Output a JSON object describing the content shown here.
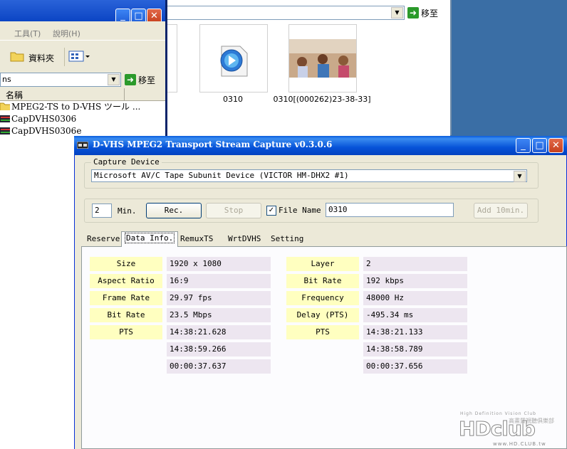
{
  "explorer": {
    "menu": [
      "工具(T)",
      "說明(H)"
    ],
    "toolbar_folder_label": "資料夾",
    "address_value": "ns",
    "go_label": "移至",
    "column_header": "名稱",
    "files": [
      {
        "name": "MPEG2-TS to D-VHS ツール ...",
        "type": "folder"
      },
      {
        "name": "CapDVHS0306",
        "type": "app"
      },
      {
        "name": "CapDVHS0306e",
        "type": "app"
      }
    ]
  },
  "thumbs": {
    "go_label": "移至",
    "items": [
      {
        "label": "0310",
        "kind": "media-icon"
      },
      {
        "label": "0310[(000262)23-38-33]",
        "kind": "video-frame"
      }
    ]
  },
  "dialog": {
    "title": "D-VHS MPEG2 Transport Stream Capture v0.3.0.6",
    "capture_device": {
      "label": "Capture Device",
      "selected": "Microsoft AV/C Tape Subunit Device (VICTOR HM-DHX2 #1)"
    },
    "record": {
      "minutes_value": "2",
      "minutes_label": "Min.",
      "rec_label": "Rec.",
      "stop_label": "Stop",
      "filename_checked": true,
      "filename_label": "File Name",
      "filename_value": "0310",
      "add_label": "Add 10min."
    },
    "tabs": [
      "Reserve",
      "Data Info.",
      "RemuxTS",
      "WrtDVHS",
      "Setting"
    ],
    "active_tab": "Data Info.",
    "video": [
      {
        "label": "Size",
        "value": "1920 x 1080"
      },
      {
        "label": "Aspect Ratio",
        "value": "16:9"
      },
      {
        "label": "Frame Rate",
        "value": "29.97 fps"
      },
      {
        "label": "Bit Rate",
        "value": "23.5 Mbps"
      },
      {
        "label": "PTS",
        "value": "14:38:21.628"
      }
    ],
    "video_pts_extra": [
      "14:38:59.266",
      "00:00:37.637"
    ],
    "audio": [
      {
        "label": "Layer",
        "value": "2"
      },
      {
        "label": "Bit Rate",
        "value": "192 kbps"
      },
      {
        "label": "Frequency",
        "value": "48000 Hz"
      },
      {
        "label": "Delay (PTS)",
        "value": "-495.34 ms"
      },
      {
        "label": "PTS",
        "value": "14:38:21.133"
      }
    ],
    "audio_pts_extra": [
      "14:38:58.789",
      "00:00:37.656"
    ]
  },
  "watermark": {
    "tagline": "High Definition Vision Club",
    "logo": "HDclub",
    "chinese": "高畫質視聽俱樂部",
    "url": "www.HD.CLUB.tw"
  },
  "colors": {
    "title_blue": "#0653d8",
    "label_yellow": "#ffffc0",
    "value_lavender": "#ede6f0",
    "desktop_blue": "#3a6ea5"
  }
}
